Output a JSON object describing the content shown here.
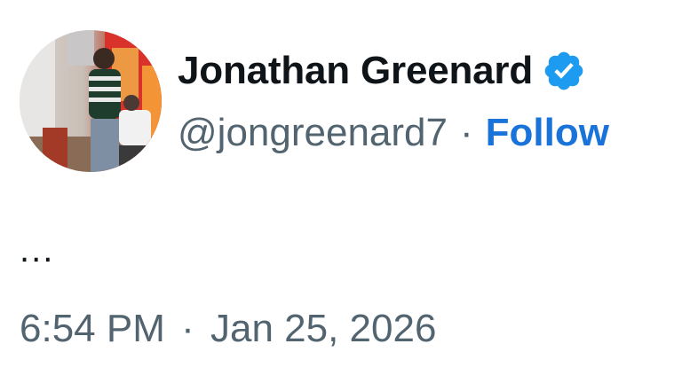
{
  "author": {
    "display_name": "Jonathan Greenard",
    "handle": "@jongreenard7",
    "separator": "·",
    "follow_label": "Follow",
    "verified": true,
    "avatar_icon": "profile-photo",
    "verified_icon": "verified-badge-icon"
  },
  "tweet": {
    "text": "...",
    "time": "6:54 PM",
    "date": "Jan 25, 2026",
    "time_separator": "·"
  },
  "colors": {
    "name": "#0f1419",
    "secondary": "#536471",
    "accent": "#1a73d9",
    "badge": "#1d9bf0"
  }
}
